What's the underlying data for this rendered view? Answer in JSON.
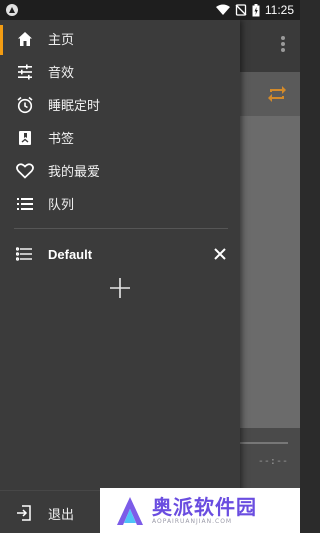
{
  "statusbar": {
    "time": "11:25"
  },
  "drawer": {
    "items": [
      {
        "label": "主页",
        "icon": "home-icon"
      },
      {
        "label": "音效",
        "icon": "equalizer-icon"
      },
      {
        "label": "睡眠定时",
        "icon": "alarm-clock-icon"
      },
      {
        "label": "书签",
        "icon": "bookmark-icon"
      },
      {
        "label": "我的最爱",
        "icon": "heart-icon"
      },
      {
        "label": "队列",
        "icon": "queue-list-icon"
      }
    ],
    "active_index": 0,
    "playlist": {
      "name": "Default",
      "icon": "playlist-icon"
    },
    "add_icon": "plus-icon",
    "exit_label": "退出",
    "exit_icon": "exit-icon"
  },
  "background": {
    "time_display": "--:--"
  },
  "watermark": {
    "text_cn": "奥派软件园",
    "text_en": "AOPAIRUANJIAN.COM"
  },
  "colors": {
    "accent": "#f39c12",
    "repeat_icon": "#d38a2a",
    "watermark_text": "#6a4de0"
  }
}
